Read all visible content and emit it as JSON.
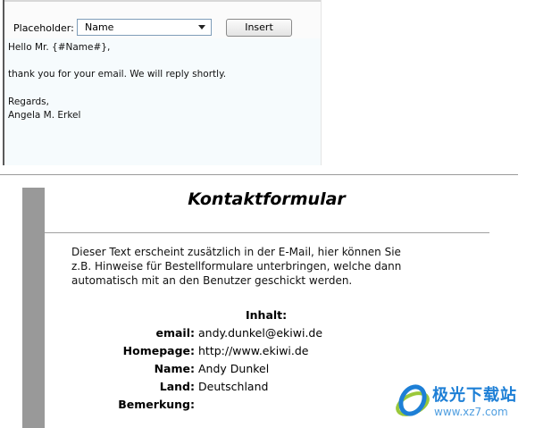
{
  "editor": {
    "placeholder_label": "Placeholder:",
    "placeholder_selected": "Name",
    "insert_label": "Insert",
    "body_lines": [
      "Hello Mr. {#Name#},",
      "",
      "thank you for your email. We will reply shortly.",
      "",
      "Regards,",
      "Angela M. Erkel"
    ]
  },
  "form": {
    "title": "Kontaktformular",
    "description_lines": [
      "Dieser Text erscheint zusätzlich in der E-Mail, hier können Sie",
      "z.B. Hinweise für Bestellformulare unterbringen, welche dann",
      "automatisch mit an den Benutzer geschickt werden."
    ],
    "section_label": "Inhalt:",
    "fields": [
      {
        "label": "email:",
        "value": "andy.dunkel@ekiwi.de"
      },
      {
        "label": "Homepage:",
        "value": "http://www.ekiwi.de"
      },
      {
        "label": "Name:",
        "value": "Andy Dunkel"
      },
      {
        "label": "Land:",
        "value": "Deutschland"
      },
      {
        "label": "Bemerkung:",
        "value": ""
      }
    ]
  },
  "watermark": {
    "brand": "极光下载站",
    "url": "www.xz7.com"
  },
  "colors": {
    "editor_bg": "#f6fbfd",
    "side_bar": "#999999",
    "watermark_blue": "#1d7fd6"
  }
}
